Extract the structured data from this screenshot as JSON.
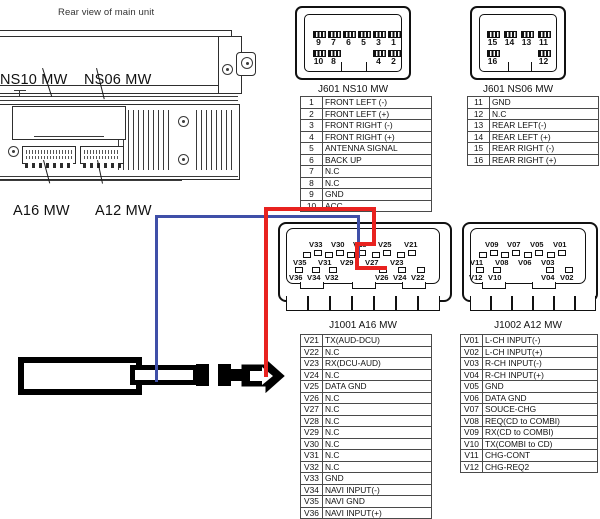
{
  "figure": {
    "caption": "Rear view of main unit",
    "unit_connector_labels": [
      {
        "name": "NS10 MW"
      },
      {
        "name": "NS06 MW"
      },
      {
        "name": "A16 MW"
      },
      {
        "name": "A12 MW"
      }
    ]
  },
  "colors": {
    "wire_blue": "#3f4fa8",
    "wire_red": "#e8221f",
    "line": "#111111",
    "table_border": "#4a4a4a"
  },
  "connectors": [
    {
      "id": "j601-ns10",
      "title": "J601 NS10 MW",
      "pin_rows": {
        "top": [
          "9",
          "7",
          "6",
          "5",
          "3",
          "1"
        ],
        "bottom": [
          "10",
          "8",
          "4",
          "2"
        ]
      },
      "table": [
        {
          "pin": "1",
          "signal": "FRONT LEFT (-)"
        },
        {
          "pin": "2",
          "signal": "FRONT LEFT (+)"
        },
        {
          "pin": "3",
          "signal": "FRONT RIGHT (-)"
        },
        {
          "pin": "4",
          "signal": "FRONT RIGHT (+)"
        },
        {
          "pin": "5",
          "signal": "ANTENNA SIGNAL"
        },
        {
          "pin": "6",
          "signal": "BACK UP"
        },
        {
          "pin": "7",
          "signal": "N.C"
        },
        {
          "pin": "8",
          "signal": "N.C"
        },
        {
          "pin": "9",
          "signal": "GND"
        },
        {
          "pin": "10",
          "signal": "ACC"
        }
      ]
    },
    {
      "id": "j601-ns06",
      "title": "J601 NS06 MW",
      "pin_rows": {
        "top": [
          "15",
          "14",
          "13",
          "11"
        ],
        "bottom": [
          "16",
          "12"
        ]
      },
      "table": [
        {
          "pin": "11",
          "signal": "GND"
        },
        {
          "pin": "12",
          "signal": "N.C"
        },
        {
          "pin": "13",
          "signal": "REAR LEFT(-)"
        },
        {
          "pin": "14",
          "signal": "REAR LEFT (+)"
        },
        {
          "pin": "15",
          "signal": "REAR RIGHT (-)"
        },
        {
          "pin": "16",
          "signal": "REAR RIGHT (+)"
        }
      ]
    },
    {
      "id": "j1001-a16",
      "title": "J1001  A16 MW",
      "pin_rows": {
        "top": [
          "V33",
          "V30",
          "V28",
          "V25",
          "V21"
        ],
        "middle": [
          "V35",
          "V31",
          "V29",
          "V27",
          "V23"
        ],
        "bottom": [
          "V36",
          "V34",
          "V32",
          "V26",
          "V24",
          "V22"
        ]
      },
      "table": [
        {
          "pin": "V21",
          "signal": "TX(AUD-DCU)"
        },
        {
          "pin": "V22",
          "signal": "N.C"
        },
        {
          "pin": "V23",
          "signal": "RX(DCU-AUD)"
        },
        {
          "pin": "V24",
          "signal": "N.C"
        },
        {
          "pin": "V25",
          "signal": "DATA GND"
        },
        {
          "pin": "V26",
          "signal": "N.C"
        },
        {
          "pin": "V27",
          "signal": "N.C"
        },
        {
          "pin": "V28",
          "signal": "N.C"
        },
        {
          "pin": "V29",
          "signal": "N.C"
        },
        {
          "pin": "V30",
          "signal": "N.C"
        },
        {
          "pin": "V31",
          "signal": "N.C"
        },
        {
          "pin": "V32",
          "signal": "N.C"
        },
        {
          "pin": "V33",
          "signal": "GND"
        },
        {
          "pin": "V34",
          "signal": "NAVI INPUT(-)"
        },
        {
          "pin": "V35",
          "signal": "NAVI GND"
        },
        {
          "pin": "V36",
          "signal": "NAVI INPUT(+)"
        }
      ]
    },
    {
      "id": "j1002-a12",
      "title": "J1002  A12 MW",
      "pin_rows": {
        "top": [
          "V09",
          "V07",
          "V05",
          "V01"
        ],
        "middle": [
          "V11",
          "V08",
          "V06",
          "V03"
        ],
        "bottom": [
          "V12",
          "V10",
          "V04",
          "V02"
        ]
      },
      "table": [
        {
          "pin": "V01",
          "signal": "L-CH INPUT(-)"
        },
        {
          "pin": "V02",
          "signal": "L-CH INPUT(+)"
        },
        {
          "pin": "V03",
          "signal": "R-CH INPUT(-)"
        },
        {
          "pin": "V04",
          "signal": "R-CH INPUT(+)"
        },
        {
          "pin": "V05",
          "signal": "GND"
        },
        {
          "pin": "V06",
          "signal": "DATA GND"
        },
        {
          "pin": "V07",
          "signal": "SOUCE-CHG"
        },
        {
          "pin": "V08",
          "signal": "REQ(CD to COMBI)"
        },
        {
          "pin": "V09",
          "signal": "RX(CD to COMBI)"
        },
        {
          "pin": "V10",
          "signal": "TX(COMBI to CD)"
        },
        {
          "pin": "V11",
          "signal": "CHG-CONT"
        },
        {
          "pin": "V12",
          "signal": "CHG-REQ2"
        }
      ]
    }
  ],
  "plug": {
    "name": "3.5mm TRS plug",
    "wires": [
      {
        "color_name": "blue",
        "from": "plug-ring",
        "to": "V28"
      },
      {
        "color_name": "red",
        "from": "plug-tip",
        "to": "V26"
      }
    ]
  }
}
